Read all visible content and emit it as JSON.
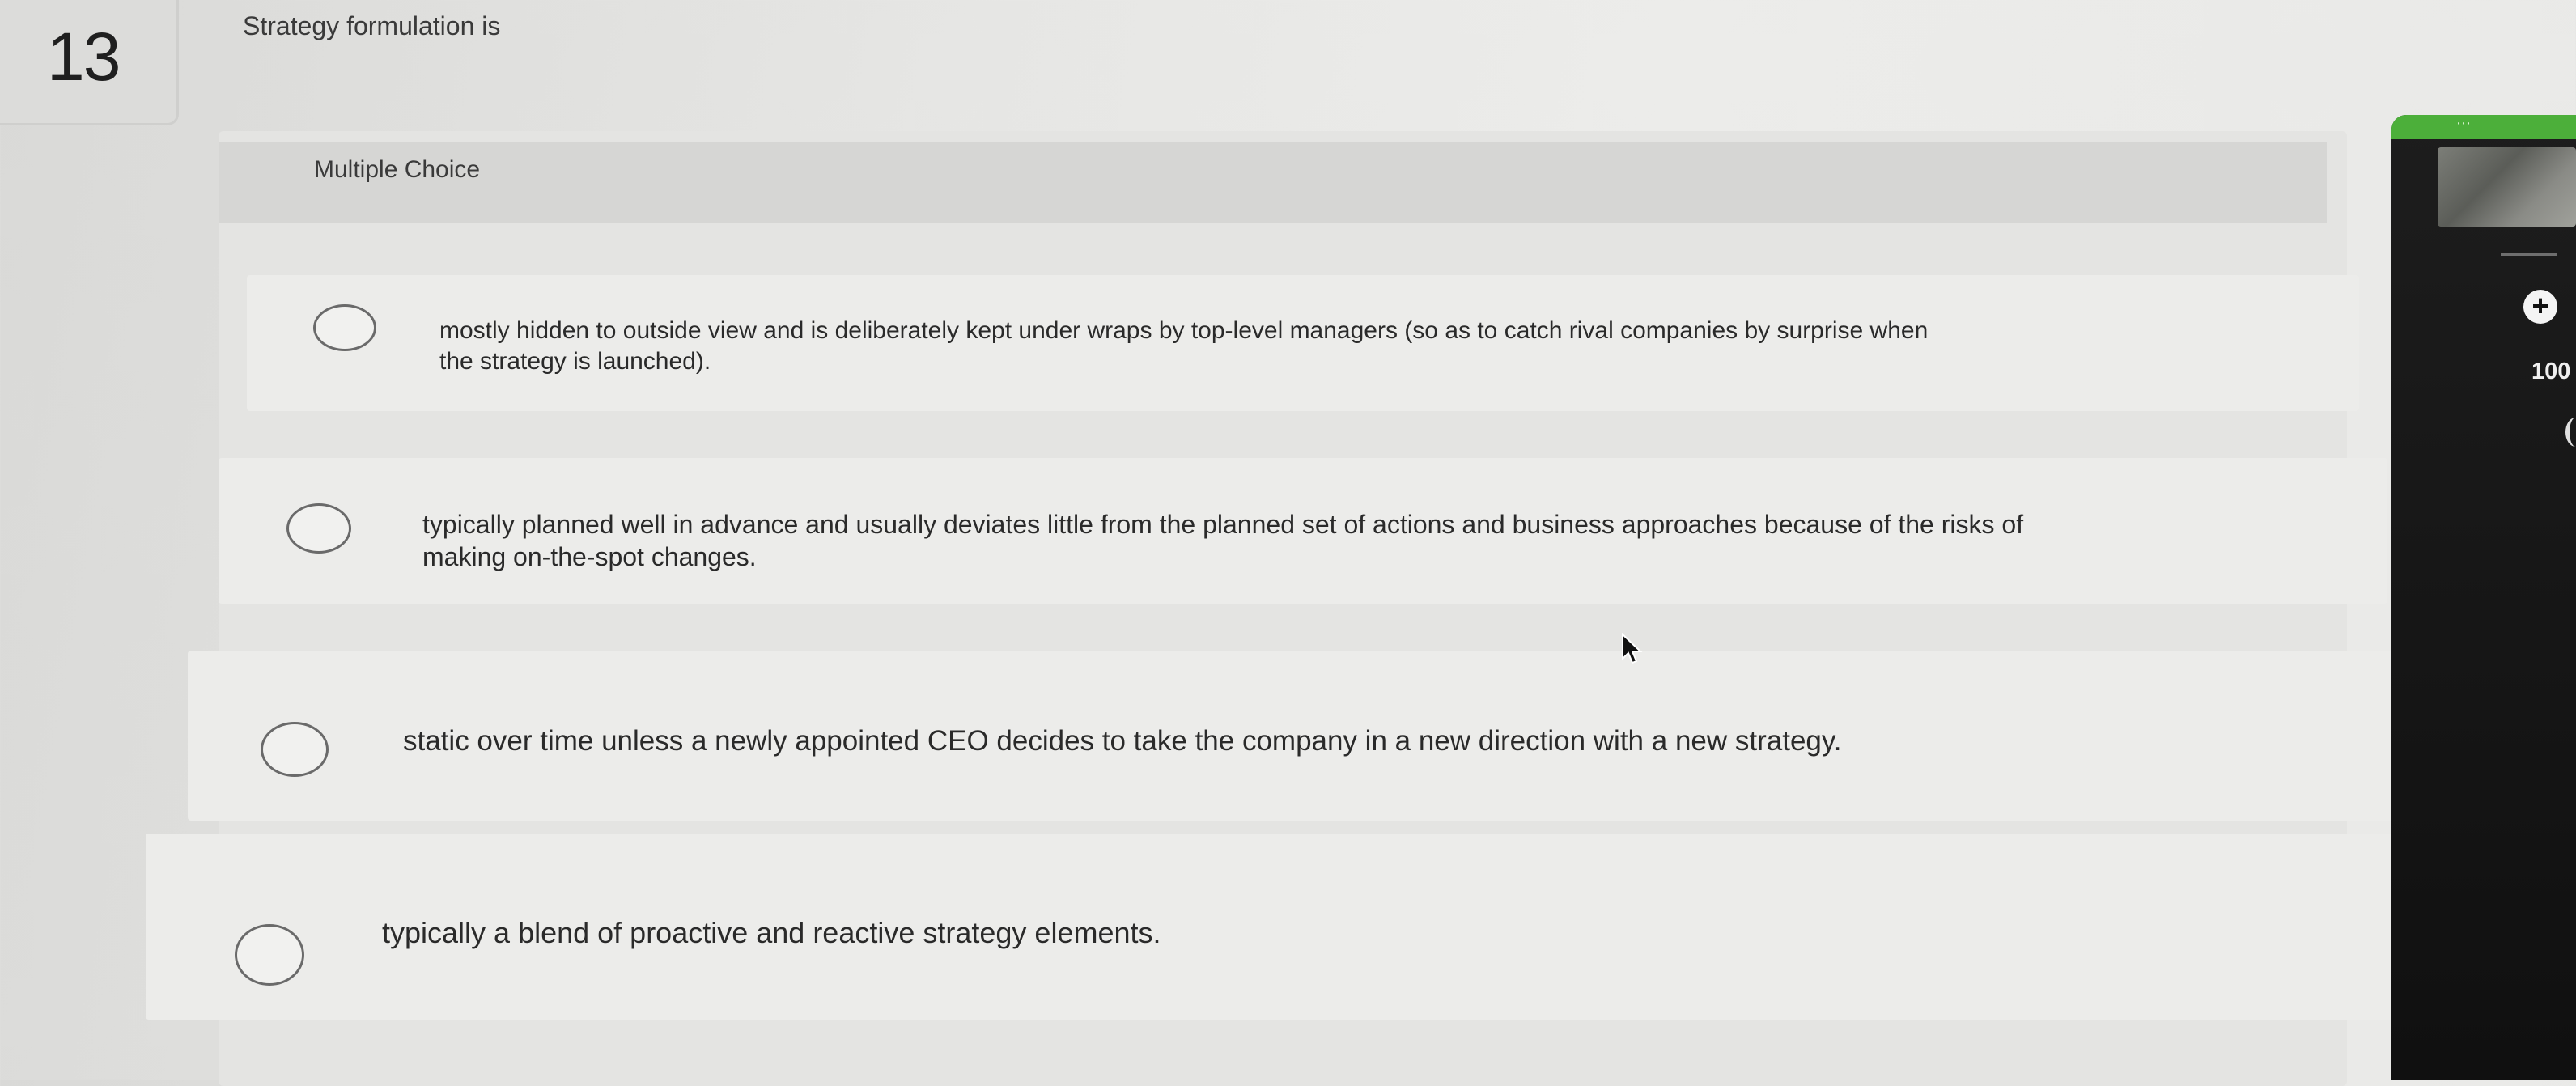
{
  "question": {
    "number": "13",
    "prompt": "Strategy formulation is",
    "type_label": "Multiple Choice"
  },
  "options": [
    {
      "line1": "mostly hidden to outside view and is deliberately kept under wraps by top-level managers (so as to catch rival companies by surprise when",
      "line2": "the strategy is launched)."
    },
    {
      "line1": "typically planned well in advance and usually deviates little from the planned set of actions and business approaches because of the risks of",
      "line2": "making on-the-spot changes."
    },
    {
      "line1": "static over time unless a newly appointed CEO decides to take the company in a new direction with a new strategy."
    },
    {
      "line1": "typically a blend of proactive and reactive strategy elements."
    }
  ],
  "side_panel": {
    "handle_dots": "⋯",
    "zoom": "100",
    "plus_icon": "plus-circle-icon",
    "accent_color": "#4caf3a"
  }
}
